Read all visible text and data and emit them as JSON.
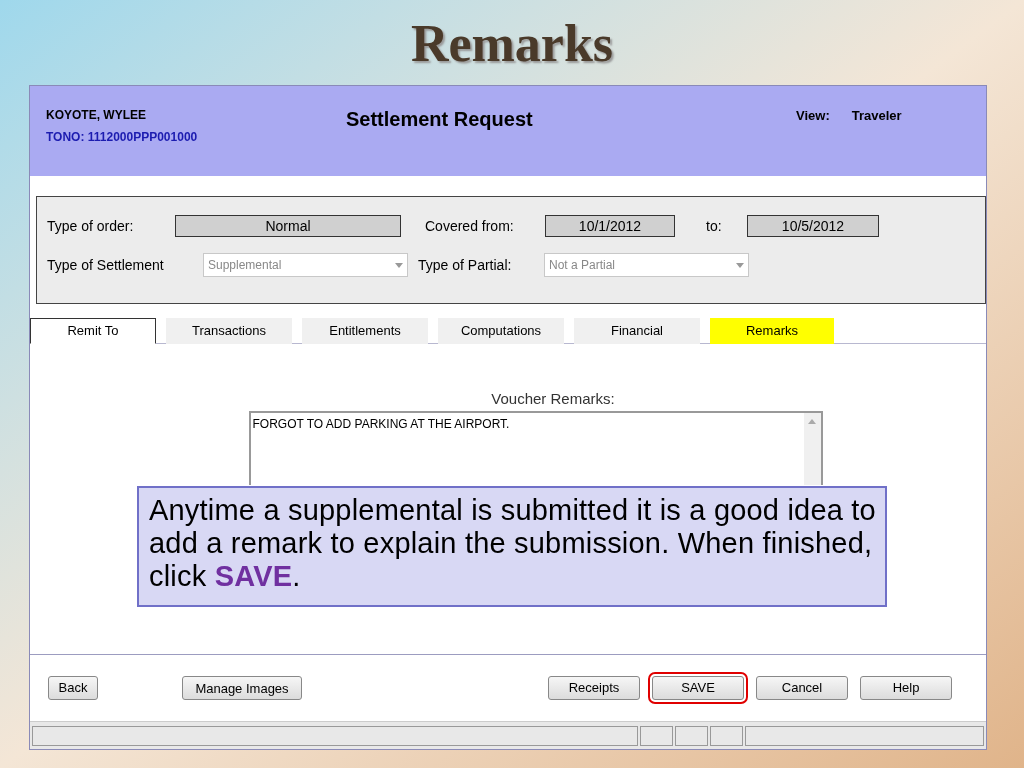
{
  "slide_title": "Remarks",
  "header": {
    "name": "KOYOTE, WYLEE",
    "tono": "TONO: 1112000PPP001000",
    "title": "Settlement Request",
    "view_label": "View:",
    "view_value": "Traveler"
  },
  "form": {
    "order_label": "Type of order:",
    "order_value": "Normal",
    "covered_label": "Covered from:",
    "covered_from": "10/1/2012",
    "to_label": "to:",
    "covered_to": "10/5/2012",
    "settlement_label": "Type of Settlement",
    "settlement_value": "Supplemental",
    "partial_label": "Type of Partial:",
    "partial_value": "Not a Partial"
  },
  "tabs": [
    {
      "label": "Remit To",
      "selected": true,
      "highlighted": false
    },
    {
      "label": "Transactions",
      "selected": false,
      "highlighted": false
    },
    {
      "label": "Entitlements",
      "selected": false,
      "highlighted": false
    },
    {
      "label": "Computations",
      "selected": false,
      "highlighted": false
    },
    {
      "label": "Financial",
      "selected": false,
      "highlighted": false
    },
    {
      "label": "Remarks",
      "selected": false,
      "highlighted": true
    }
  ],
  "remarks": {
    "label": "Voucher Remarks:",
    "value": "FORGOT TO ADD PARKING AT THE AIRPORT."
  },
  "callout": "Anytime a supplemental is submitted it is a good idea to add a remark to explain the submission. When finished, click **SAVE**.",
  "buttons_left": [
    {
      "label": "Back",
      "highlighted": false
    },
    {
      "label": "Manage Images",
      "highlighted": false
    }
  ],
  "buttons_right": [
    {
      "label": "Receipts",
      "highlighted": false
    },
    {
      "label": "SAVE",
      "highlighted": true
    },
    {
      "label": "Cancel",
      "highlighted": false
    },
    {
      "label": "Help",
      "highlighted": false
    }
  ]
}
